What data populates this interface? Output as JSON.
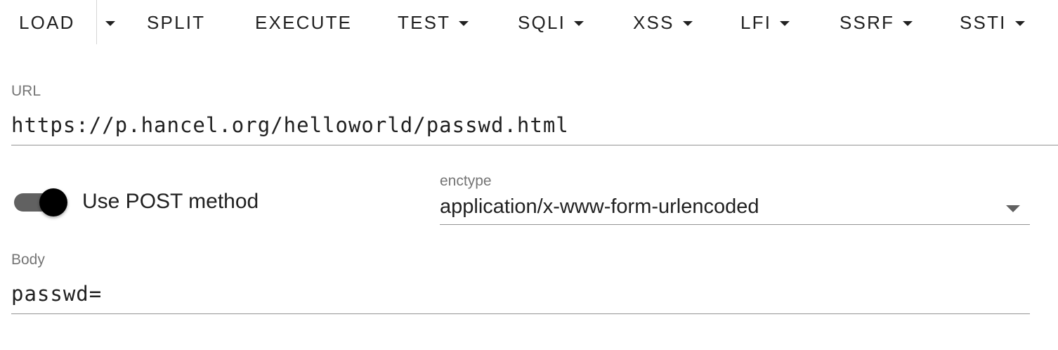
{
  "toolbar": {
    "load": "LOAD",
    "split": "SPLIT",
    "execute": "EXECUTE",
    "test": "TEST",
    "sqli": "SQLI",
    "xss": "XSS",
    "lfi": "LFI",
    "ssrf": "SSRF",
    "ssti": "SSTI"
  },
  "url": {
    "label": "URL",
    "value": "https://p.hancel.org/helloworld/passwd.html"
  },
  "post_toggle": {
    "label": "Use POST method",
    "enabled": true
  },
  "enctype": {
    "label": "enctype",
    "value": "application/x-www-form-urlencoded"
  },
  "body": {
    "label": "Body",
    "value": "passwd="
  },
  "icons": {
    "dropdown": "caret-down-icon"
  }
}
